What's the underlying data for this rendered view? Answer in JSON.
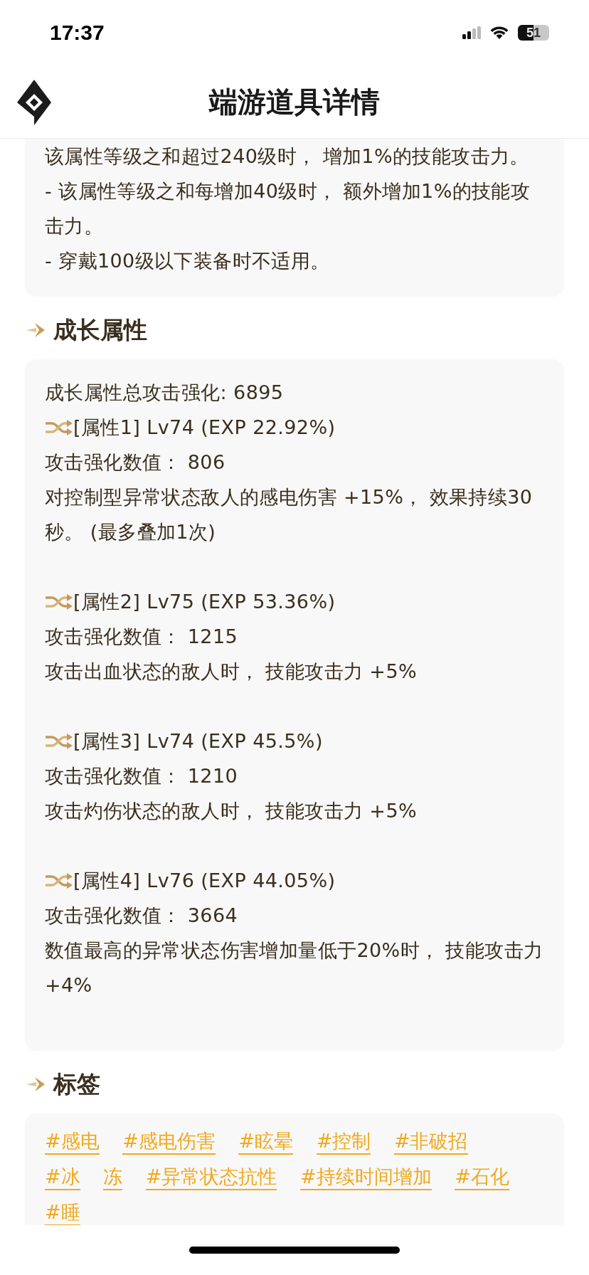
{
  "status_bar": {
    "time": "17:37",
    "battery": "51"
  },
  "header": {
    "title": "端游道具详情"
  },
  "intro_card": {
    "lines": [
      "该属性等级之和超过240级时， 增加1%的技能攻击力。",
      "- 该属性等级之和每增加40级时， 额外增加1%的技能攻击力。",
      "- 穿戴100级以下装备时不适用。"
    ]
  },
  "sections": [
    {
      "kind": "attributes",
      "title": "成长属性",
      "total": "成长属性总攻击强化: 6895",
      "attributes": [
        {
          "heading": "[属性1] Lv74 (EXP 22.92%)",
          "value": "攻击强化数值： 806",
          "effect": "对控制型异常状态敌人的感电伤害 +15%， 效果持续30秒。 (最多叠加1次)"
        },
        {
          "heading": "[属性2] Lv75 (EXP 53.36%)",
          "value": "攻击强化数值： 1215",
          "effect": "攻击出血状态的敌人时， 技能攻击力 +5%"
        },
        {
          "heading": "[属性3] Lv74 (EXP 45.5%)",
          "value": "攻击强化数值： 1210",
          "effect": "攻击灼伤状态的敌人时， 技能攻击力 +5%"
        },
        {
          "heading": "[属性4] Lv76 (EXP 44.05%)",
          "value": "攻击强化数值： 3664",
          "effect": "数值最高的异常状态伤害增加量低于20%时， 技能攻击力 +4%"
        }
      ]
    },
    {
      "kind": "tags",
      "title": "标签",
      "tags": [
        "#感电",
        "#感电伤害",
        "#眩晕",
        "#控制",
        "#非破招",
        "#冰",
        "冻",
        "#异常状态抗性",
        "#持续时间增加",
        "#石化",
        "#睡"
      ]
    }
  ]
}
